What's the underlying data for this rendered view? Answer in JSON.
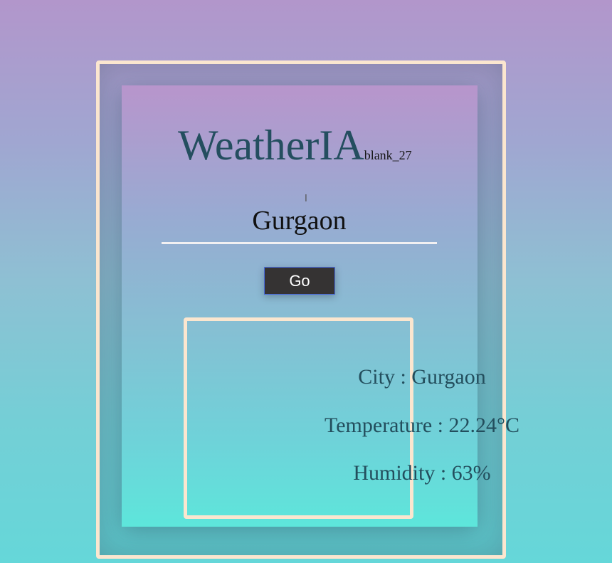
{
  "app": {
    "title": "WeatherIA",
    "subtitle": "blank_27"
  },
  "search": {
    "value": "Gurgaon"
  },
  "actions": {
    "go_label": "Go"
  },
  "result": {
    "city": "City : Gurgaon",
    "temperature": "Temperature : 22.24°C",
    "humidity": "Humidity : 63%"
  },
  "colors": {
    "frame": "#fbe6cf",
    "title": "#244e5f",
    "button": "#353333"
  }
}
